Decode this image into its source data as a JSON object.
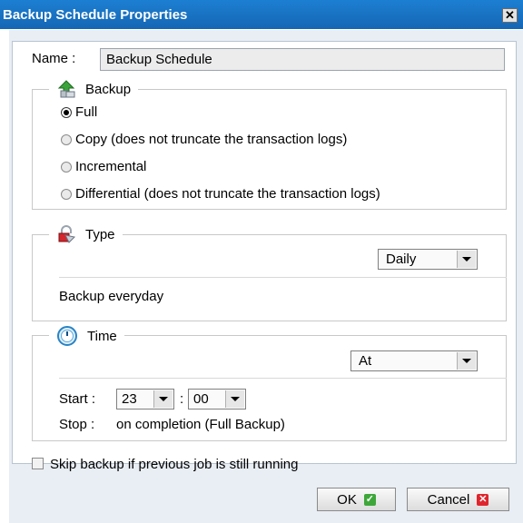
{
  "window": {
    "title": "Backup Schedule Properties",
    "close_glyph": "✕"
  },
  "name": {
    "label": "Name :",
    "value": "Backup Schedule"
  },
  "backup": {
    "legend": "Backup",
    "icon": "backup-arrow-icon",
    "options": [
      {
        "label": "Full",
        "selected": true
      },
      {
        "label": "Copy (does not truncate the transaction logs)",
        "selected": false
      },
      {
        "label": "Incremental",
        "selected": false
      },
      {
        "label": "Differential (does not truncate the transaction logs)",
        "selected": false
      }
    ]
  },
  "type": {
    "legend": "Type",
    "icon": "lock-icon",
    "select_value": "Daily",
    "description": "Backup everyday"
  },
  "time": {
    "legend": "Time",
    "icon": "clock-icon",
    "select_value": "At",
    "start_label": "Start :",
    "start_hour": "23",
    "separator": ":",
    "start_minute": "00",
    "stop_label": "Stop :",
    "stop_value": "on completion (Full Backup)"
  },
  "skip": {
    "label": "Skip backup if previous job is still running",
    "checked": false
  },
  "buttons": {
    "ok": "OK",
    "cancel": "Cancel"
  },
  "colors": {
    "title_bar": "#1566b4",
    "ok_icon": "#3ea73a",
    "cancel_icon": "#e0242b"
  }
}
